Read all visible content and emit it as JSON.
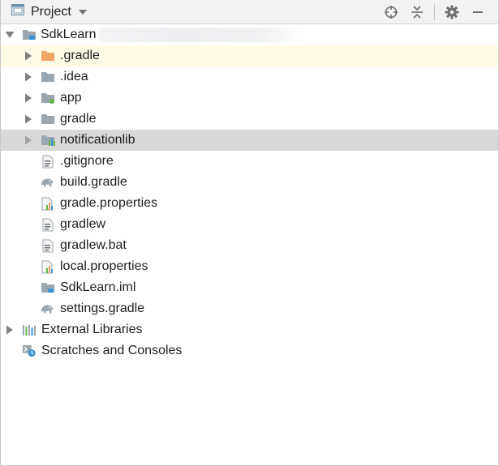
{
  "toolbar": {
    "title": "Project",
    "buttons": [
      "target-icon",
      "collapse-all-icon",
      "gear-icon",
      "hide-icon"
    ]
  },
  "tree": {
    "root_label": "SdkLearn",
    "items": [
      {
        "label": ".gradle",
        "icon": "folder-orange-icon"
      },
      {
        "label": ".idea",
        "icon": "folder-icon"
      },
      {
        "label": "app",
        "icon": "module-folder-icon"
      },
      {
        "label": "gradle",
        "icon": "folder-icon"
      },
      {
        "label": "notificationlib",
        "icon": "library-module-folder-icon"
      },
      {
        "label": ".gitignore",
        "icon": "text-file-icon"
      },
      {
        "label": "build.gradle",
        "icon": "gradle-elephant-icon"
      },
      {
        "label": "gradle.properties",
        "icon": "properties-file-icon"
      },
      {
        "label": "gradlew",
        "icon": "text-file-icon"
      },
      {
        "label": "gradlew.bat",
        "icon": "text-file-icon"
      },
      {
        "label": "local.properties",
        "icon": "properties-file-icon"
      },
      {
        "label": "SdkLearn.iml",
        "icon": "iml-module-file-icon"
      },
      {
        "label": "settings.gradle",
        "icon": "gradle-elephant-icon"
      }
    ],
    "external_libraries": "External Libraries",
    "scratches": "Scratches and Consoles"
  },
  "colors": {
    "selection_yellow": "#fffbe4",
    "selection_gray": "#d8d8d8",
    "folder_gray": "#9aa7b0",
    "folder_orange": "#f4a462",
    "accent_blue": "#3a92d6",
    "accent_green": "#62b543"
  }
}
